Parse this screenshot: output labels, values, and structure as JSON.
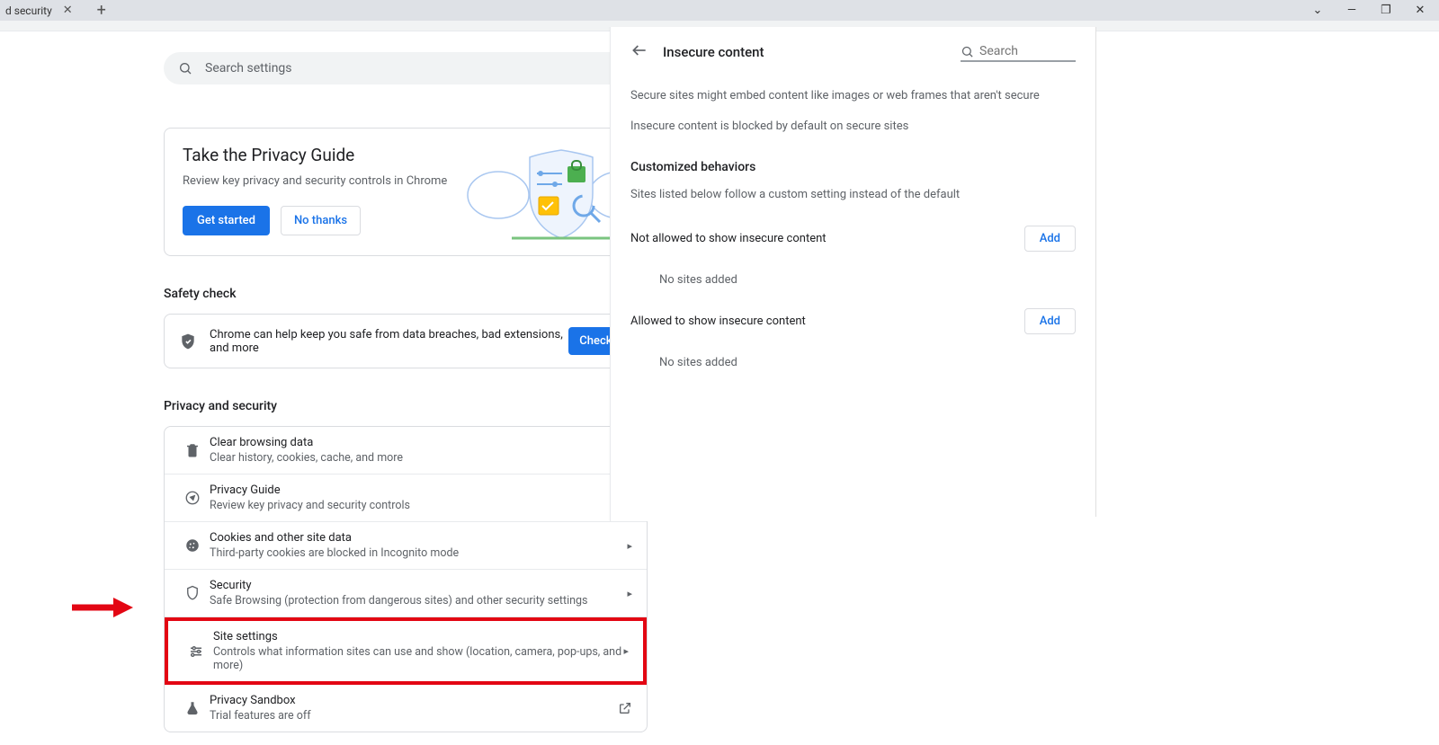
{
  "tab": {
    "title": "d security"
  },
  "window_controls": {
    "dropdown": "⌄",
    "min": "—",
    "max": "❐",
    "close": "✕"
  },
  "search": {
    "placeholder": "Search settings"
  },
  "privacy_guide_card": {
    "title": "Take the Privacy Guide",
    "subtitle": "Review key privacy and security controls in Chrome",
    "get_started": "Get started",
    "no_thanks": "No thanks"
  },
  "safety_check": {
    "heading": "Safety check",
    "text": "Chrome can help keep you safe from data breaches, bad extensions, and more",
    "button": "Check n"
  },
  "privacy_section": {
    "heading": "Privacy and security",
    "rows": [
      {
        "title": "Clear browsing data",
        "sub": "Clear history, cookies, cache, and more"
      },
      {
        "title": "Privacy Guide",
        "sub": "Review key privacy and security controls"
      },
      {
        "title": "Cookies and other site data",
        "sub": "Third-party cookies are blocked in Incognito mode"
      },
      {
        "title": "Security",
        "sub": "Safe Browsing (protection from dangerous sites) and other security settings"
      },
      {
        "title": "Site settings",
        "sub": "Controls what information sites can use and show (location, camera, pop-ups, and more)"
      },
      {
        "title": "Privacy Sandbox",
        "sub": "Trial features are off"
      }
    ]
  },
  "side_panel": {
    "title": "Insecure content",
    "search_placeholder": "Search",
    "desc1": "Secure sites might embed content like images or web frames that aren't secure",
    "desc2": "Insecure content is blocked by default on secure sites",
    "custom_heading": "Customized behaviors",
    "custom_sub": "Sites listed below follow a custom setting instead of the default",
    "not_allowed_label": "Not allowed to show insecure content",
    "allowed_label": "Allowed to show insecure content",
    "add": "Add",
    "no_sites": "No sites added"
  }
}
